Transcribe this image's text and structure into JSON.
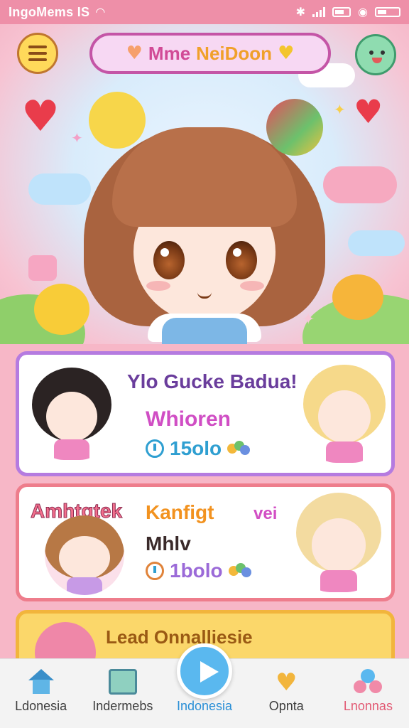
{
  "status_bar": {
    "carrier": "IngoMems IS",
    "wifi_icon": "wifi-icon",
    "bluetooth_icon": "bluetooth-icon"
  },
  "header": {
    "title_part1": "Mme",
    "title_part2": "NeiDoon",
    "menu_icon": "hamburger-menu-icon",
    "profile_icon": "smiley-profile-icon"
  },
  "cards": [
    {
      "title": "Ylo Gucke Badua!",
      "subtitle": "Whioren",
      "stat": "15olo",
      "border_color": "#b57be0"
    },
    {
      "badge": "Amhtgtek",
      "title": "Kanfigt",
      "title_tail": "vei",
      "subtitle": "Mhlv",
      "stat": "1bolo",
      "border_color": "#ee7d8c"
    },
    {
      "title": "Lead Onnalliesie",
      "border_color": "#f2b53c"
    }
  ],
  "bottom_nav": {
    "items": [
      {
        "label": "Ldonesia",
        "icon": "home-icon"
      },
      {
        "label": "Indermebs",
        "icon": "box-icon"
      },
      {
        "label": "Indonesia",
        "icon": "play-icon",
        "active": true
      },
      {
        "label": "Opnta",
        "icon": "heart-chat-icon"
      },
      {
        "label": "Lnonnas",
        "icon": "people-icon"
      }
    ]
  }
}
